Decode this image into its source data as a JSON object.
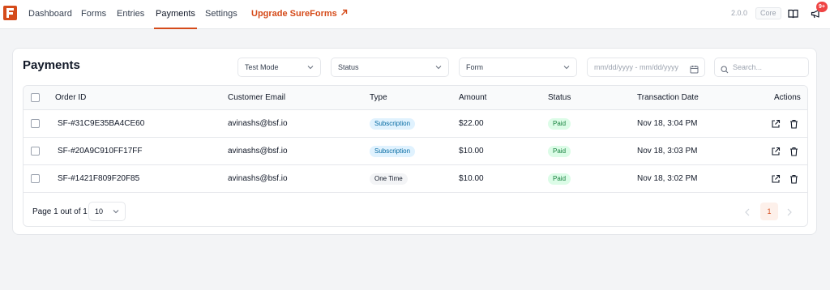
{
  "nav": {
    "items": [
      {
        "label": "Dashboard"
      },
      {
        "label": "Forms"
      },
      {
        "label": "Entries"
      },
      {
        "label": "Payments"
      },
      {
        "label": "Settings"
      }
    ],
    "upgrade_label": "Upgrade SureForms",
    "version": "2.0.0",
    "plan_badge": "Core",
    "notification_count": "9+",
    "accent_color": "#d54b1a"
  },
  "page": {
    "title": "Payments"
  },
  "filters": {
    "mode": "Test Mode",
    "status": "Status",
    "form": "Form",
    "date_placeholder": "mm/dd/yyyy - mm/dd/yyyy",
    "search_placeholder": "Search..."
  },
  "table": {
    "headers": {
      "order_id": "Order ID",
      "email": "Customer Email",
      "type": "Type",
      "amount": "Amount",
      "status": "Status",
      "date": "Transaction Date",
      "actions": "Actions"
    },
    "rows": [
      {
        "order_id": "SF-#31C9E35BA4CE60",
        "email": "avinashs@bsf.io",
        "type": "Subscription",
        "amount": "$22.00",
        "status": "Paid",
        "date": "Nov 18, 3:04 PM"
      },
      {
        "order_id": "SF-#20A9C910FF17FF",
        "email": "avinashs@bsf.io",
        "type": "Subscription",
        "amount": "$10.00",
        "status": "Paid",
        "date": "Nov 18, 3:03 PM"
      },
      {
        "order_id": "SF-#1421F809F20F85",
        "email": "avinashs@bsf.io",
        "type": "One Time",
        "amount": "$10.00",
        "status": "Paid",
        "date": "Nov 18, 3:02 PM"
      }
    ]
  },
  "pagination": {
    "info": "Page 1 out of 1",
    "per_page": "10",
    "current_page": "1"
  },
  "icons": [
    "logo-icon",
    "external-link-arrow-icon",
    "book-icon",
    "megaphone-icon",
    "chevron-down-icon",
    "calendar-icon",
    "search-icon",
    "open-external-icon",
    "trash-icon",
    "chevron-left-icon",
    "chevron-right-icon"
  ]
}
